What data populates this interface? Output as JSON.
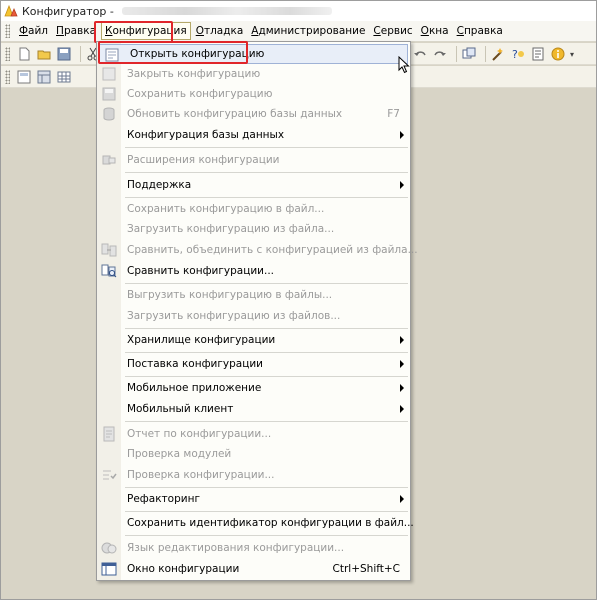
{
  "window": {
    "title": "Конфигуратор -"
  },
  "menubar": {
    "items": [
      {
        "label": "Файл",
        "u": "Ф",
        "rest": "айл"
      },
      {
        "label": "Правка",
        "u": "П",
        "rest": "равка"
      },
      {
        "label": "Конфигурация",
        "u": "К",
        "rest": "онфигурация"
      },
      {
        "label": "Отладка",
        "u": "О",
        "rest": "тладка"
      },
      {
        "label": "Администрирование",
        "u": "А",
        "rest": "дминистрирование"
      },
      {
        "label": "Сервис",
        "u": "С",
        "rest": "ервис"
      },
      {
        "label": "Окна",
        "u": "О",
        "rest": "кна"
      },
      {
        "label": "Справка",
        "u": "С",
        "rest": "правка"
      }
    ]
  },
  "dropdown": {
    "items": [
      {
        "label": "Открыть конфигурацию",
        "shortcut": "",
        "submenu": false,
        "disabled": false,
        "highlighted": true,
        "icon": "open-config-icon"
      },
      {
        "label": "Закрыть конфигурацию",
        "shortcut": "",
        "submenu": false,
        "disabled": true,
        "icon": "close-config-icon"
      },
      {
        "label": "Сохранить конфигурацию",
        "shortcut": "",
        "submenu": false,
        "disabled": true,
        "icon": "save-config-icon"
      },
      {
        "label": "Обновить конфигурацию базы данных",
        "shortcut": "F7",
        "submenu": false,
        "disabled": true,
        "icon": "update-db-icon"
      },
      {
        "label": "Конфигурация базы данных",
        "shortcut": "",
        "submenu": true,
        "disabled": false,
        "icon": ""
      },
      {
        "label": "Расширения конфигурации",
        "shortcut": "",
        "submenu": false,
        "disabled": true,
        "icon": "extensions-icon"
      },
      {
        "label": "Поддержка",
        "shortcut": "",
        "submenu": true,
        "disabled": false,
        "icon": ""
      },
      {
        "label": "Сохранить конфигурацию в файл...",
        "shortcut": "",
        "submenu": false,
        "disabled": true,
        "icon": ""
      },
      {
        "label": "Загрузить конфигурацию из файла...",
        "shortcut": "",
        "submenu": false,
        "disabled": true,
        "icon": ""
      },
      {
        "label": "Сравнить, объединить с конфигурацией из файла...",
        "shortcut": "",
        "submenu": false,
        "disabled": true,
        "icon": "compare-merge-icon"
      },
      {
        "label": "Сравнить конфигурации...",
        "shortcut": "",
        "submenu": false,
        "disabled": false,
        "icon": "compare-icon"
      },
      {
        "label": "Выгрузить конфигурацию в файлы...",
        "shortcut": "",
        "submenu": false,
        "disabled": true,
        "icon": ""
      },
      {
        "label": "Загрузить конфигурацию из файлов...",
        "shortcut": "",
        "submenu": false,
        "disabled": true,
        "icon": ""
      },
      {
        "label": "Хранилище конфигурации",
        "shortcut": "",
        "submenu": true,
        "disabled": false,
        "icon": ""
      },
      {
        "label": "Поставка конфигурации",
        "shortcut": "",
        "submenu": true,
        "disabled": false,
        "icon": ""
      },
      {
        "label": "Мобильное приложение",
        "shortcut": "",
        "submenu": true,
        "disabled": false,
        "icon": ""
      },
      {
        "label": "Мобильный клиент",
        "shortcut": "",
        "submenu": true,
        "disabled": false,
        "icon": ""
      },
      {
        "label": "Отчет по конфигурации...",
        "shortcut": "",
        "submenu": false,
        "disabled": true,
        "icon": "report-icon"
      },
      {
        "label": "Проверка модулей",
        "shortcut": "",
        "submenu": false,
        "disabled": true,
        "icon": ""
      },
      {
        "label": "Проверка конфигурации...",
        "shortcut": "",
        "submenu": false,
        "disabled": true,
        "icon": "check-config-icon"
      },
      {
        "label": "Рефакторинг",
        "shortcut": "",
        "submenu": true,
        "disabled": false,
        "icon": ""
      },
      {
        "label": "Сохранить идентификатор конфигурации в файл...",
        "shortcut": "",
        "submenu": false,
        "disabled": false,
        "icon": ""
      },
      {
        "label": "Язык редактирования конфигурации...",
        "shortcut": "",
        "submenu": false,
        "disabled": true,
        "icon": "language-icon"
      },
      {
        "label": "Окно конфигурации",
        "shortcut": "Ctrl+Shift+C",
        "submenu": false,
        "disabled": false,
        "icon": "config-window-icon"
      }
    ]
  }
}
